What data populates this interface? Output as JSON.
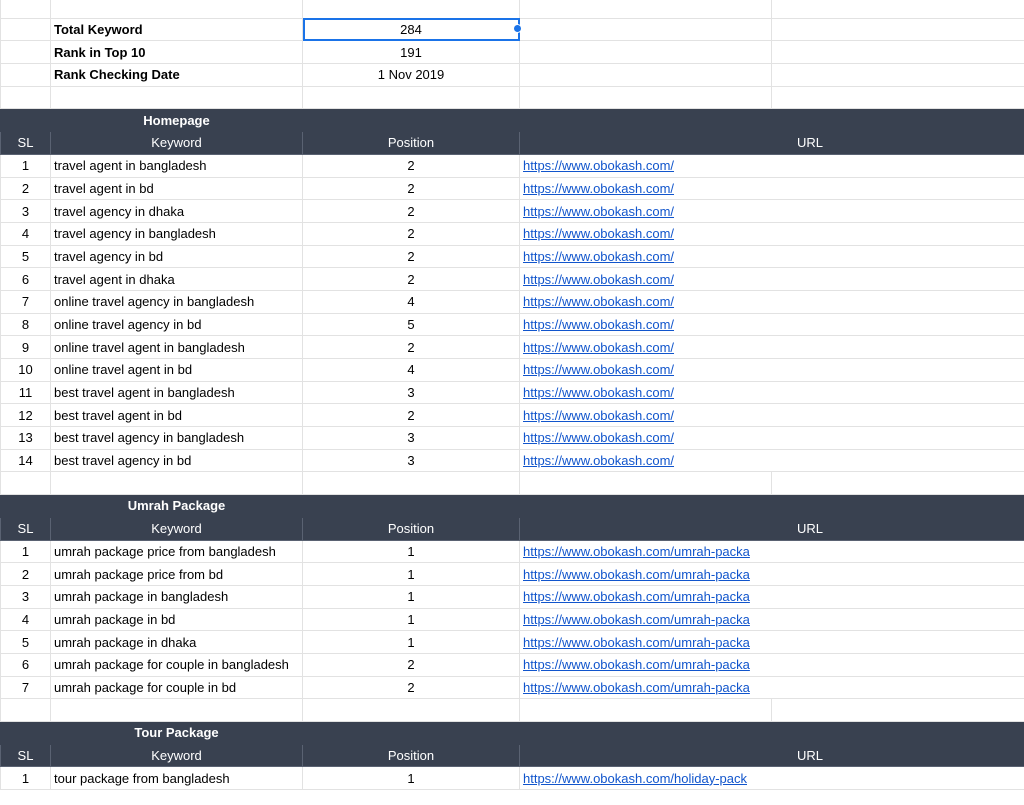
{
  "summary": [
    {
      "label": "Total Keyword",
      "value": "284"
    },
    {
      "label": "Rank in Top 10",
      "value": "191"
    },
    {
      "label": "Rank Checking Date",
      "value": "1 Nov 2019"
    }
  ],
  "columns": {
    "sl": "SL",
    "keyword": "Keyword",
    "position": "Position",
    "url": "URL"
  },
  "sections": [
    {
      "title": "Homepage",
      "rows": [
        {
          "sl": "1",
          "keyword": "travel agent in bangladesh",
          "position": "2",
          "url": "https://www.obokash.com/"
        },
        {
          "sl": "2",
          "keyword": "travel agent in bd",
          "position": "2",
          "url": "https://www.obokash.com/"
        },
        {
          "sl": "3",
          "keyword": "travel agency in dhaka",
          "position": "2",
          "url": "https://www.obokash.com/"
        },
        {
          "sl": "4",
          "keyword": "travel agency in bangladesh",
          "position": "2",
          "url": "https://www.obokash.com/"
        },
        {
          "sl": "5",
          "keyword": "travel agency in bd",
          "position": "2",
          "url": "https://www.obokash.com/"
        },
        {
          "sl": "6",
          "keyword": "travel agent in dhaka",
          "position": "2",
          "url": "https://www.obokash.com/"
        },
        {
          "sl": "7",
          "keyword": "online travel agency in bangladesh",
          "position": "4",
          "url": "https://www.obokash.com/"
        },
        {
          "sl": "8",
          "keyword": "online travel agency in bd",
          "position": "5",
          "url": "https://www.obokash.com/"
        },
        {
          "sl": "9",
          "keyword": "online travel agent in bangladesh",
          "position": "2",
          "url": "https://www.obokash.com/"
        },
        {
          "sl": "10",
          "keyword": "online travel agent in bd",
          "position": "4",
          "url": "https://www.obokash.com/"
        },
        {
          "sl": "11",
          "keyword": "best travel agent in bangladesh",
          "position": "3",
          "url": "https://www.obokash.com/"
        },
        {
          "sl": "12",
          "keyword": "best travel agent in bd",
          "position": "2",
          "url": "https://www.obokash.com/"
        },
        {
          "sl": "13",
          "keyword": "best travel agency in bangladesh",
          "position": "3",
          "url": "https://www.obokash.com/"
        },
        {
          "sl": "14",
          "keyword": "best travel agency in bd",
          "position": "3",
          "url": "https://www.obokash.com/"
        }
      ]
    },
    {
      "title": "Umrah Package",
      "rows": [
        {
          "sl": "1",
          "keyword": "umrah package price from bangladesh",
          "position": "1",
          "url": "https://www.obokash.com/umrah-packa"
        },
        {
          "sl": "2",
          "keyword": "umrah package price from bd",
          "position": "1",
          "url": "https://www.obokash.com/umrah-packa"
        },
        {
          "sl": "3",
          "keyword": "umrah package in bangladesh",
          "position": "1",
          "url": "https://www.obokash.com/umrah-packa"
        },
        {
          "sl": "4",
          "keyword": "umrah package in bd",
          "position": "1",
          "url": "https://www.obokash.com/umrah-packa"
        },
        {
          "sl": "5",
          "keyword": "umrah package in dhaka",
          "position": "1",
          "url": "https://www.obokash.com/umrah-packa"
        },
        {
          "sl": "6",
          "keyword": "umrah package for couple in bangladesh",
          "position": "2",
          "url": "https://www.obokash.com/umrah-packa"
        },
        {
          "sl": "7",
          "keyword": "umrah package for couple in bd",
          "position": "2",
          "url": "https://www.obokash.com/umrah-packa"
        }
      ]
    },
    {
      "title": "Tour Package",
      "rows": [
        {
          "sl": "1",
          "keyword": "tour package from bangladesh",
          "position": "1",
          "url": "https://www.obokash.com/holiday-pack"
        }
      ]
    }
  ]
}
